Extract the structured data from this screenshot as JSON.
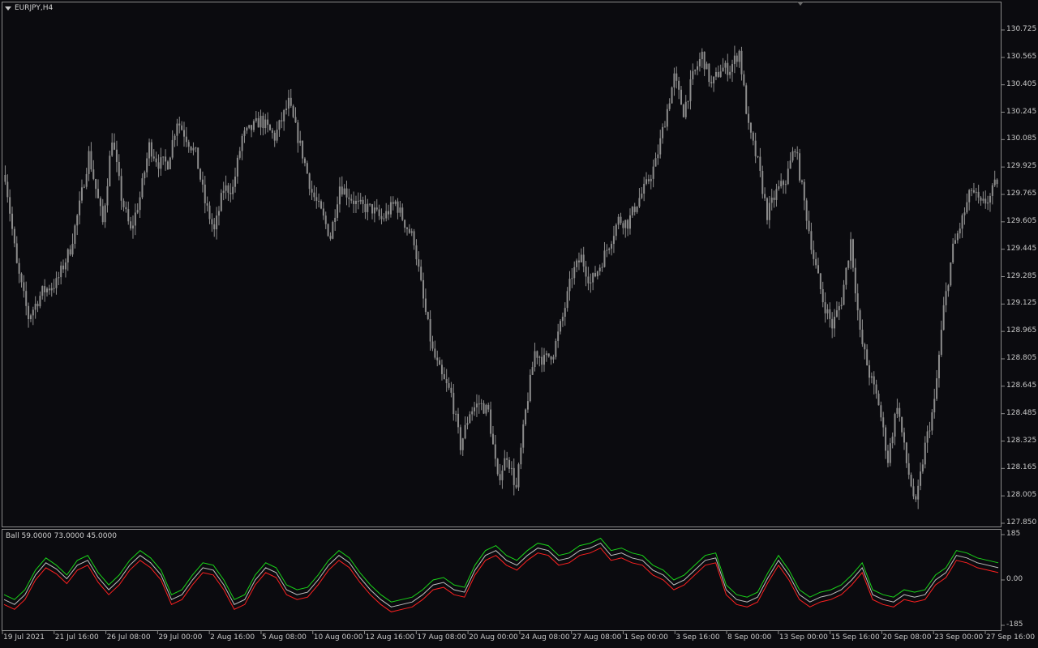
{
  "header": {
    "symbol_title": "EURJPY,H4",
    "indicator_title": "Ball 59.0000 73.0000 45.0000"
  },
  "icons": [
    "collapse-triangle-icon",
    "chart-shift-marker-icon"
  ],
  "colors": {
    "background": "#0b0b0f",
    "candle": "#8c8c8c",
    "green_line": "#19d419",
    "silver_line": "#c0c0c0",
    "red_line": "#ff2020",
    "frame": "#8a8a8a",
    "text": "#c8c8c8"
  },
  "chart_data": [
    {
      "type": "candlestick",
      "title": "EURJPY,H4",
      "ylim": [
        127.85,
        130.725
      ],
      "price_ticks": [
        "130.725",
        "130.565",
        "130.405",
        "130.245",
        "130.085",
        "129.925",
        "129.765",
        "129.605",
        "129.445",
        "129.285",
        "129.125",
        "128.965",
        "128.805",
        "128.645",
        "128.485",
        "128.325",
        "128.165",
        "128.005",
        "127.850"
      ],
      "time_ticks": [
        "19 Jul 2021",
        "21 Jul 16:00",
        "26 Jul 08:00",
        "29 Jul 00:00",
        "2 Aug 16:00",
        "5 Aug 08:00",
        "10 Aug 00:00",
        "12 Aug 16:00",
        "17 Aug 08:00",
        "20 Aug 00:00",
        "24 Aug 08:00",
        "27 Aug 08:00",
        "1 Sep 00:00",
        "3 Sep 16:00",
        "8 Sep 00:00",
        "13 Sep 00:00",
        "15 Sep 16:00",
        "20 Sep 08:00",
        "23 Sep 00:00",
        "27 Sep 16:00"
      ],
      "close_path": [
        [
          0,
          129.88
        ],
        [
          5,
          129.35
        ],
        [
          10,
          129.05
        ],
        [
          16,
          129.2
        ],
        [
          22,
          129.25
        ],
        [
          28,
          129.45
        ],
        [
          32,
          129.7
        ],
        [
          36,
          130.0
        ],
        [
          42,
          129.6
        ],
        [
          46,
          130.1
        ],
        [
          50,
          129.75
        ],
        [
          54,
          129.55
        ],
        [
          58,
          129.75
        ],
        [
          62,
          130.05
        ],
        [
          66,
          129.95
        ],
        [
          70,
          129.95
        ],
        [
          74,
          130.2
        ],
        [
          78,
          130.1
        ],
        [
          82,
          130.0
        ],
        [
          86,
          129.72
        ],
        [
          90,
          129.55
        ],
        [
          94,
          129.8
        ],
        [
          98,
          129.8
        ],
        [
          102,
          130.1
        ],
        [
          106,
          130.15
        ],
        [
          110,
          130.2
        ],
        [
          116,
          130.1
        ],
        [
          122,
          130.3
        ],
        [
          128,
          130.0
        ],
        [
          132,
          129.78
        ],
        [
          136,
          129.66
        ],
        [
          140,
          129.52
        ],
        [
          144,
          129.82
        ],
        [
          148,
          129.76
        ],
        [
          152,
          129.7
        ],
        [
          158,
          129.68
        ],
        [
          162,
          129.62
        ],
        [
          168,
          129.72
        ],
        [
          172,
          129.6
        ],
        [
          176,
          129.5
        ],
        [
          180,
          129.15
        ],
        [
          184,
          128.85
        ],
        [
          188,
          128.7
        ],
        [
          192,
          128.6
        ],
        [
          196,
          128.3
        ],
        [
          200,
          128.5
        ],
        [
          204,
          128.55
        ],
        [
          208,
          128.5
        ],
        [
          212,
          128.1
        ],
        [
          216,
          128.25
        ],
        [
          220,
          128.05
        ],
        [
          224,
          128.5
        ],
        [
          228,
          128.85
        ],
        [
          232,
          128.8
        ],
        [
          236,
          128.85
        ],
        [
          240,
          129.05
        ],
        [
          244,
          129.3
        ],
        [
          248,
          129.4
        ],
        [
          252,
          129.25
        ],
        [
          256,
          129.35
        ],
        [
          260,
          129.48
        ],
        [
          264,
          129.62
        ],
        [
          268,
          129.6
        ],
        [
          272,
          129.72
        ],
        [
          276,
          129.82
        ],
        [
          280,
          129.95
        ],
        [
          284,
          130.2
        ],
        [
          288,
          130.45
        ],
        [
          292,
          130.25
        ],
        [
          296,
          130.45
        ],
        [
          300,
          130.58
        ],
        [
          304,
          130.4
        ],
        [
          308,
          130.5
        ],
        [
          312,
          130.5
        ],
        [
          316,
          130.6
        ],
        [
          320,
          130.15
        ],
        [
          324,
          129.95
        ],
        [
          328,
          129.65
        ],
        [
          332,
          129.78
        ],
        [
          336,
          129.85
        ],
        [
          340,
          130.05
        ],
        [
          344,
          129.72
        ],
        [
          348,
          129.4
        ],
        [
          352,
          129.15
        ],
        [
          356,
          129.0
        ],
        [
          360,
          129.15
        ],
        [
          364,
          129.5
        ],
        [
          368,
          128.95
        ],
        [
          372,
          128.72
        ],
        [
          376,
          128.55
        ],
        [
          380,
          128.22
        ],
        [
          384,
          128.55
        ],
        [
          388,
          128.2
        ],
        [
          392,
          127.95
        ],
        [
          396,
          128.3
        ],
        [
          400,
          128.55
        ],
        [
          404,
          129.1
        ],
        [
          408,
          129.45
        ],
        [
          412,
          129.62
        ],
        [
          416,
          129.8
        ],
        [
          420,
          129.7
        ],
        [
          424,
          129.75
        ],
        [
          427,
          129.85
        ]
      ]
    },
    {
      "type": "line",
      "title": "Ball 59.0000 73.0000 45.0000",
      "ylim": [
        -185,
        185
      ],
      "y_ticks": [
        "185",
        "0.00",
        "-185"
      ],
      "series": [
        {
          "name": "59.0000",
          "color": "#19d419",
          "values": [
            -60,
            -80,
            -40,
            40,
            90,
            60,
            20,
            80,
            100,
            30,
            -20,
            20,
            80,
            120,
            90,
            40,
            -60,
            -40,
            20,
            70,
            60,
            0,
            -80,
            -60,
            20,
            70,
            50,
            -20,
            -40,
            -30,
            20,
            80,
            120,
            90,
            30,
            -20,
            -60,
            -90,
            -80,
            -70,
            -40,
            0,
            10,
            -20,
            -30,
            60,
            120,
            140,
            100,
            80,
            120,
            150,
            140,
            100,
            110,
            140,
            150,
            170,
            120,
            130,
            110,
            100,
            60,
            40,
            0,
            20,
            60,
            100,
            110,
            -20,
            -60,
            -70,
            -50,
            30,
            100,
            40,
            -40,
            -70,
            -50,
            -40,
            -20,
            20,
            70,
            -40,
            -60,
            -70,
            -40,
            -50,
            -40,
            20,
            50,
            120,
            110,
            90,
            80,
            70
          ]
        },
        {
          "name": "73.0000",
          "color": "#c0c0c0",
          "values": [
            -80,
            -100,
            -60,
            20,
            70,
            45,
            5,
            60,
            80,
            10,
            -40,
            0,
            60,
            100,
            70,
            20,
            -80,
            -60,
            0,
            50,
            40,
            -20,
            -100,
            -80,
            0,
            50,
            30,
            -40,
            -60,
            -50,
            0,
            60,
            100,
            70,
            10,
            -40,
            -80,
            -110,
            -100,
            -90,
            -60,
            -20,
            -10,
            -40,
            -50,
            40,
            100,
            120,
            80,
            60,
            100,
            130,
            120,
            80,
            90,
            120,
            130,
            150,
            100,
            110,
            90,
            80,
            40,
            20,
            -20,
            0,
            40,
            80,
            90,
            -40,
            -80,
            -90,
            -70,
            10,
            80,
            20,
            -60,
            -90,
            -70,
            -60,
            -40,
            0,
            50,
            -60,
            -80,
            -90,
            -60,
            -70,
            -60,
            0,
            30,
            100,
            90,
            70,
            60,
            50
          ]
        },
        {
          "name": "45.0000",
          "color": "#ff2020",
          "values": [
            -100,
            -120,
            -80,
            0,
            50,
            25,
            -15,
            40,
            60,
            -10,
            -60,
            -20,
            40,
            80,
            50,
            0,
            -100,
            -80,
            -20,
            30,
            20,
            -40,
            -120,
            -100,
            -20,
            30,
            10,
            -60,
            -80,
            -70,
            -20,
            40,
            80,
            50,
            -10,
            -60,
            -100,
            -130,
            -120,
            -110,
            -80,
            -40,
            -30,
            -60,
            -70,
            20,
            80,
            100,
            60,
            40,
            80,
            110,
            100,
            60,
            70,
            100,
            110,
            130,
            80,
            90,
            70,
            60,
            20,
            0,
            -40,
            -20,
            20,
            60,
            70,
            -60,
            -100,
            -110,
            -90,
            -10,
            60,
            0,
            -80,
            -110,
            -90,
            -80,
            -60,
            -20,
            30,
            -80,
            -100,
            -110,
            -80,
            -90,
            -80,
            -20,
            10,
            80,
            70,
            50,
            40,
            30
          ]
        }
      ]
    }
  ]
}
